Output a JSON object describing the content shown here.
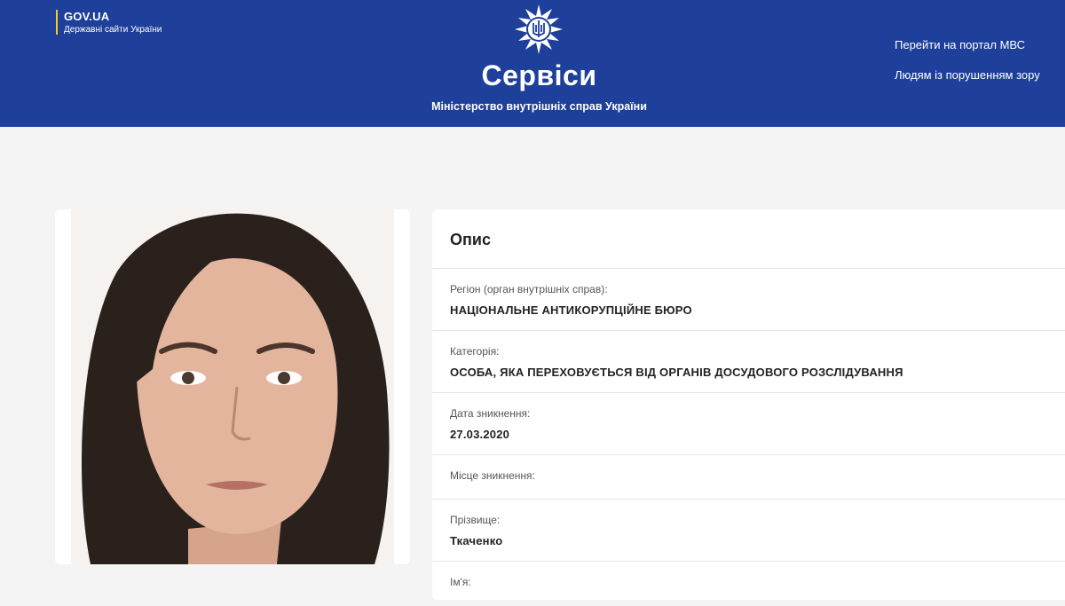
{
  "header": {
    "gov_title": "GOV.UA",
    "gov_subtitle": "Державні сайти України",
    "title": "Сервіси",
    "subtitle": "Міністерство внутрішніх справ України",
    "link_portal": "Перейти на портал МВС",
    "link_accessibility": "Людям із порушенням зору",
    "brand_color": "#1e3f9a"
  },
  "description": {
    "title": "Опис",
    "fields": [
      {
        "label": "Регіон (орган внутрішніх справ):",
        "value": "НАЦІОНАЛЬНЕ АНТИКОРУПЦІЙНЕ БЮРО"
      },
      {
        "label": "Категорія:",
        "value": "ОСОБА, ЯКА ПЕРЕХОВУЄТЬСЯ ВІД ОРГАНІВ ДОСУДОВОГО РОЗСЛІДУВАННЯ"
      },
      {
        "label": "Дата зникнення:",
        "value": "27.03.2020"
      },
      {
        "label": "Місце зникнення:",
        "value": ""
      },
      {
        "label": "Прізвище:",
        "value": "Ткаченко"
      },
      {
        "label": "Ім'я:",
        "value": ""
      }
    ]
  }
}
